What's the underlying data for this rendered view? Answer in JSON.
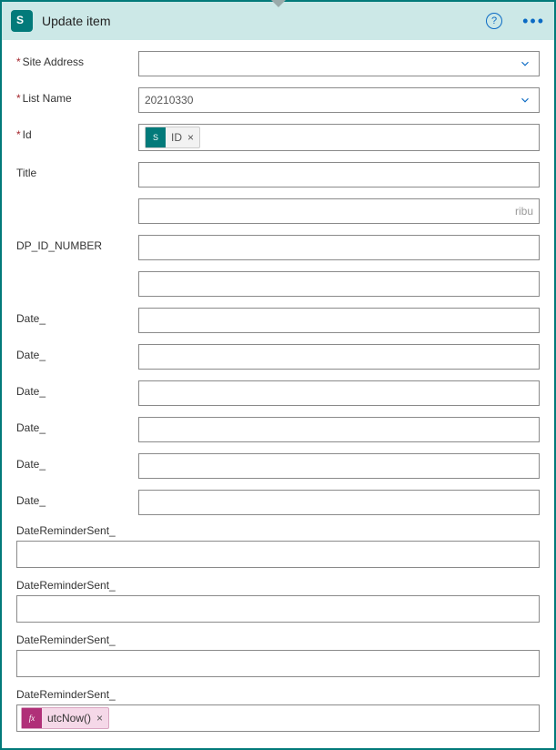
{
  "header": {
    "title": "Update item"
  },
  "rows": {
    "siteAddress": {
      "label": "Site Address",
      "value": ""
    },
    "listName": {
      "label": "List Name",
      "value": "20210330"
    },
    "id": {
      "label": "Id",
      "pill": "ID"
    },
    "title": {
      "label": "Title",
      "value": ""
    },
    "row5": {
      "label": " ",
      "value": "ribu"
    },
    "dpid": {
      "label": "DP_ID_NUMBER",
      "value": ""
    },
    "row7": {
      "label": " ",
      "value": ""
    },
    "date1": {
      "label": "Date_",
      "value": ""
    },
    "date2": {
      "label": "Date_",
      "value": ""
    },
    "date3": {
      "label": "Date_",
      "value": ""
    },
    "date4": {
      "label": "Date_",
      "value": ""
    },
    "date5": {
      "label": "Date_",
      "value": ""
    },
    "date6": {
      "label": "Date_",
      "value": ""
    }
  },
  "stacks": {
    "r1": {
      "label": "DateReminderSent_"
    },
    "r2": {
      "label": "DateReminderSent_"
    },
    "r3": {
      "label": "DateReminderSent_"
    },
    "r4": {
      "label": "DateReminderSent_",
      "fx": "utcNow()"
    }
  }
}
